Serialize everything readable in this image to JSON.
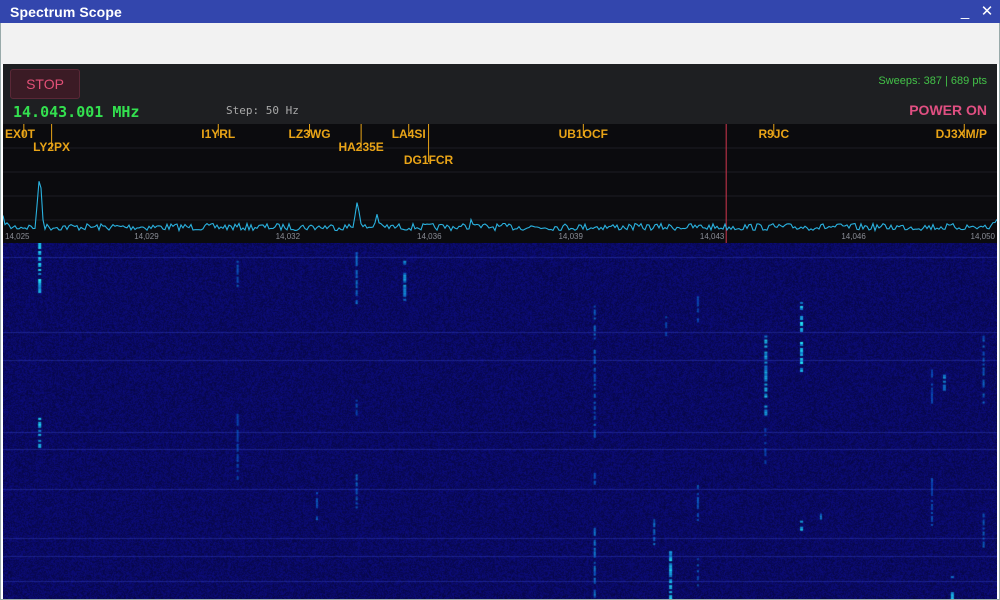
{
  "window": {
    "title": "Spectrum Scope",
    "minimize_glyph": "_",
    "close_glyph": "✕"
  },
  "controls": {
    "stop_label": "STOP",
    "frequency": "14.043.001 MHz",
    "step": "Step: 50 Hz",
    "sweeps": "Sweeps: 387 | 689 pts",
    "power_label": "POWER ON"
  },
  "colors": {
    "titlebar": "#3346ad",
    "spectrum_trace": "#2ab2e0",
    "spot_label": "#e9a417",
    "cursor_line": "#d2364e",
    "frequency_text": "#33e04f",
    "power_text": "#e14f82",
    "waterfall_bg": "#0a0a5a"
  },
  "spectrum": {
    "freq_min": 14.025,
    "freq_max": 14.05,
    "cursor_freq": 14.0432,
    "tick_labels": [
      "14,025",
      "14,029",
      "14,032",
      "14,036",
      "14,039",
      "14,043",
      "14,046",
      "14,050"
    ],
    "peaks": [
      {
        "freq": 14.0259,
        "level": 0.48
      },
      {
        "freq": 14.0339,
        "level": 0.24
      },
      {
        "freq": 14.0344,
        "level": 0.1
      },
      {
        "freq": 14.0368,
        "level": 0.06
      }
    ],
    "spots": [
      {
        "call": "EX0T",
        "freq": 14.0255,
        "row": 0
      },
      {
        "call": "LY2PX",
        "freq": 14.0262,
        "row": 1
      },
      {
        "call": "I1YRL",
        "freq": 14.0304,
        "row": 0
      },
      {
        "call": "LZ3WG",
        "freq": 14.0327,
        "row": 0
      },
      {
        "call": "HA235E",
        "freq": 14.034,
        "row": 1
      },
      {
        "call": "LA4SI",
        "freq": 14.0352,
        "row": 0
      },
      {
        "call": "DG1FCR",
        "freq": 14.0357,
        "row": 2
      },
      {
        "call": "UB1OCF",
        "freq": 14.0396,
        "row": 0
      },
      {
        "call": "R9JC",
        "freq": 14.0444,
        "row": 0
      },
      {
        "call": "DJ3XM/P",
        "freq": 14.0492,
        "row": 0
      }
    ]
  },
  "waterfall": {
    "streaks": [
      {
        "freq": 14.0259,
        "start": 0.0,
        "end": 0.14,
        "strength": 0.95
      },
      {
        "freq": 14.0259,
        "start": 0.48,
        "end": 0.57,
        "strength": 1.0
      },
      {
        "freq": 14.0309,
        "start": 0.05,
        "end": 0.12,
        "strength": 0.4
      },
      {
        "freq": 14.0309,
        "start": 0.48,
        "end": 0.66,
        "strength": 0.3
      },
      {
        "freq": 14.0329,
        "start": 0.7,
        "end": 0.78,
        "strength": 0.4
      },
      {
        "freq": 14.0339,
        "start": 0.02,
        "end": 0.17,
        "strength": 0.55
      },
      {
        "freq": 14.0339,
        "start": 0.44,
        "end": 0.48,
        "strength": 0.3
      },
      {
        "freq": 14.0339,
        "start": 0.65,
        "end": 0.75,
        "strength": 0.45
      },
      {
        "freq": 14.0351,
        "start": 0.05,
        "end": 0.16,
        "strength": 0.7
      },
      {
        "freq": 14.0399,
        "start": 0.17,
        "end": 0.27,
        "strength": 0.5
      },
      {
        "freq": 14.0399,
        "start": 0.3,
        "end": 0.55,
        "strength": 0.45
      },
      {
        "freq": 14.0399,
        "start": 0.64,
        "end": 0.68,
        "strength": 0.4
      },
      {
        "freq": 14.0399,
        "start": 0.8,
        "end": 1.0,
        "strength": 0.55
      },
      {
        "freq": 14.0417,
        "start": 0.2,
        "end": 0.26,
        "strength": 0.3
      },
      {
        "freq": 14.0418,
        "start": 0.86,
        "end": 1.0,
        "strength": 0.9
      },
      {
        "freq": 14.0414,
        "start": 0.77,
        "end": 0.85,
        "strength": 0.5
      },
      {
        "freq": 14.0425,
        "start": 0.15,
        "end": 0.22,
        "strength": 0.3
      },
      {
        "freq": 14.0425,
        "start": 0.68,
        "end": 0.79,
        "strength": 0.35
      },
      {
        "freq": 14.0425,
        "start": 0.88,
        "end": 0.96,
        "strength": 0.4
      },
      {
        "freq": 14.0442,
        "start": 0.26,
        "end": 0.48,
        "strength": 0.85
      },
      {
        "freq": 14.0442,
        "start": 0.52,
        "end": 0.62,
        "strength": 0.3
      },
      {
        "freq": 14.0451,
        "start": 0.16,
        "end": 0.36,
        "strength": 0.95
      },
      {
        "freq": 14.0451,
        "start": 0.78,
        "end": 0.81,
        "strength": 0.9
      },
      {
        "freq": 14.0456,
        "start": 0.76,
        "end": 0.78,
        "strength": 0.6
      },
      {
        "freq": 14.0484,
        "start": 0.35,
        "end": 0.45,
        "strength": 0.3
      },
      {
        "freq": 14.0484,
        "start": 0.66,
        "end": 0.8,
        "strength": 0.3
      },
      {
        "freq": 14.0487,
        "start": 0.37,
        "end": 0.41,
        "strength": 0.7
      },
      {
        "freq": 14.0489,
        "start": 0.93,
        "end": 1.0,
        "strength": 0.85
      },
      {
        "freq": 14.0497,
        "start": 0.26,
        "end": 0.45,
        "strength": 0.45
      },
      {
        "freq": 14.0497,
        "start": 0.76,
        "end": 0.86,
        "strength": 0.4
      }
    ],
    "bands": [
      0.04,
      0.25,
      0.33,
      0.53,
      0.58,
      0.69,
      0.83,
      0.88,
      0.95
    ]
  }
}
